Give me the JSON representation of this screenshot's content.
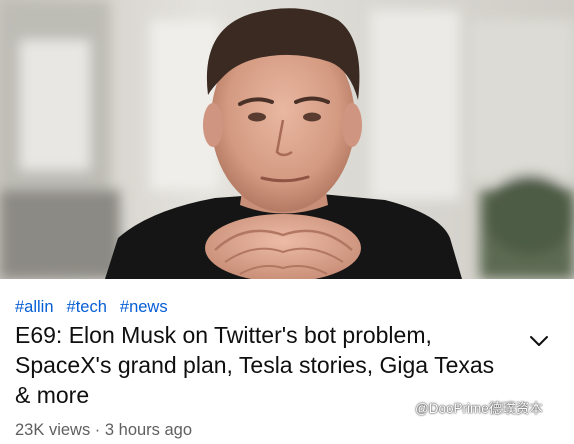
{
  "video": {
    "hashtags": [
      "#allin",
      "#tech",
      "#news"
    ],
    "title": "E69: Elon Musk on Twitter's bot problem, SpaceX's grand plan, Tesla stories, Giga Texas & more",
    "views": "23K views",
    "separator": "·",
    "age": "3 hours ago"
  },
  "icons": {
    "expand": "chevron-down-icon",
    "watermark": "wechat-channel-icon"
  },
  "watermark": {
    "text": "@DooPrime德璞资本"
  },
  "colors": {
    "hashtag": "#065fd4",
    "title": "#0f0f0f",
    "secondary": "#606060"
  }
}
